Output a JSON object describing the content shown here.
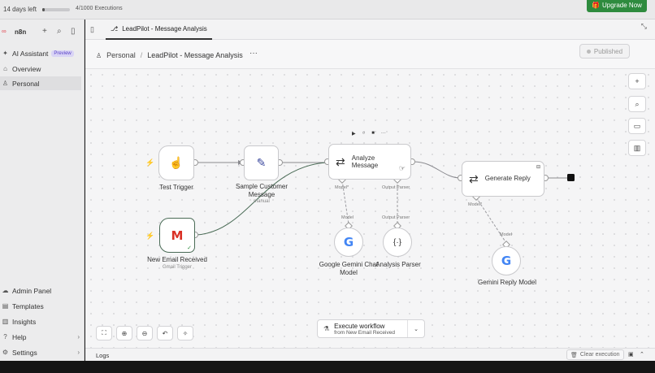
{
  "trial": {
    "days_left": "14 days left",
    "executions": "4/1000 Executions",
    "progress": 0.1
  },
  "upgrade": {
    "label": "Upgrade Now",
    "icon": "gift-icon"
  },
  "brand": "n8n",
  "sidebar": {
    "items": [
      {
        "label": "AI Assistant",
        "badge": "Preview",
        "icon": "sparkle-icon"
      },
      {
        "label": "Overview",
        "icon": "home-icon"
      },
      {
        "label": "Personal",
        "icon": "user-icon"
      }
    ],
    "bottom_items": [
      {
        "label": "Admin Panel",
        "icon": "cloud-icon"
      },
      {
        "label": "Templates",
        "icon": "templates-icon"
      },
      {
        "label": "Insights",
        "icon": "insights-icon"
      },
      {
        "label": "Help",
        "icon": "help-icon"
      },
      {
        "label": "Settings",
        "icon": "settings-icon"
      }
    ]
  },
  "tab": {
    "label": "LeadPilot - Message Analysis"
  },
  "breadcrumb": {
    "project": "Personal",
    "separator": "/",
    "workflow": "LeadPilot - Message Analysis"
  },
  "header": {
    "more": "···",
    "published": "Published"
  },
  "nodes": {
    "test_trigger": {
      "label": "Test Trigger"
    },
    "sample_message": {
      "label_line1": "Sample Customer",
      "label_line2": "Message",
      "sub": "manual"
    },
    "new_email": {
      "label": "New Email Received",
      "sub": "Gmail Trigger"
    },
    "analyze": {
      "title_line1": "Analyze",
      "title_line2": "Message",
      "port_model": "Model*",
      "port_parser": "Output Parser"
    },
    "generate": {
      "title": "Generate Reply",
      "port_model": "Model*"
    },
    "gemini_chat": {
      "label_line1": "Google Gemini Chat",
      "label_line2": "Model",
      "port": "Model"
    },
    "analysis_parser": {
      "label": "Analysis Parser",
      "port": "Output Parser"
    },
    "gemini_reply": {
      "label": "Gemini Reply Model",
      "port": "Model"
    }
  },
  "execute": {
    "line1": "Execute workflow",
    "line2": "from New Email Received"
  },
  "logs": {
    "label": "Logs",
    "clear": "Clear execution"
  }
}
